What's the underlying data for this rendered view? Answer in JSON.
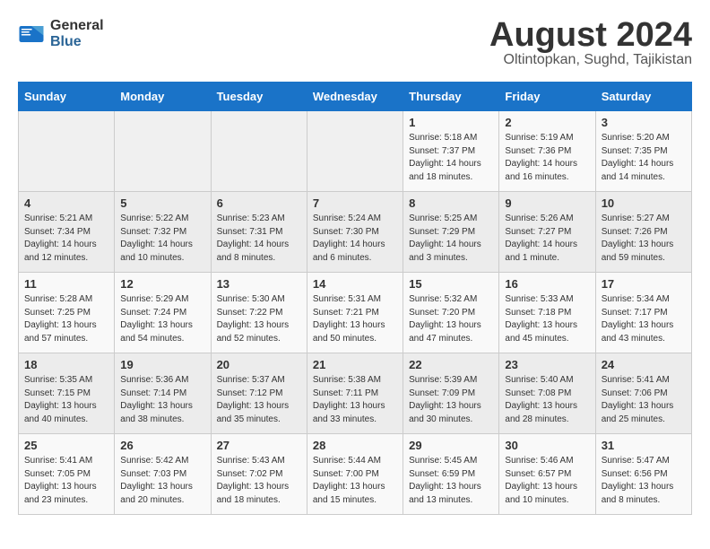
{
  "header": {
    "logo_general": "General",
    "logo_blue": "Blue",
    "month_title": "August 2024",
    "location": "Oltintopkan, Sughd, Tajikistan"
  },
  "weekdays": [
    "Sunday",
    "Monday",
    "Tuesday",
    "Wednesday",
    "Thursday",
    "Friday",
    "Saturday"
  ],
  "weeks": [
    [
      {
        "day": "",
        "info": ""
      },
      {
        "day": "",
        "info": ""
      },
      {
        "day": "",
        "info": ""
      },
      {
        "day": "",
        "info": ""
      },
      {
        "day": "1",
        "info": "Sunrise: 5:18 AM\nSunset: 7:37 PM\nDaylight: 14 hours\nand 18 minutes."
      },
      {
        "day": "2",
        "info": "Sunrise: 5:19 AM\nSunset: 7:36 PM\nDaylight: 14 hours\nand 16 minutes."
      },
      {
        "day": "3",
        "info": "Sunrise: 5:20 AM\nSunset: 7:35 PM\nDaylight: 14 hours\nand 14 minutes."
      }
    ],
    [
      {
        "day": "4",
        "info": "Sunrise: 5:21 AM\nSunset: 7:34 PM\nDaylight: 14 hours\nand 12 minutes."
      },
      {
        "day": "5",
        "info": "Sunrise: 5:22 AM\nSunset: 7:32 PM\nDaylight: 14 hours\nand 10 minutes."
      },
      {
        "day": "6",
        "info": "Sunrise: 5:23 AM\nSunset: 7:31 PM\nDaylight: 14 hours\nand 8 minutes."
      },
      {
        "day": "7",
        "info": "Sunrise: 5:24 AM\nSunset: 7:30 PM\nDaylight: 14 hours\nand 6 minutes."
      },
      {
        "day": "8",
        "info": "Sunrise: 5:25 AM\nSunset: 7:29 PM\nDaylight: 14 hours\nand 3 minutes."
      },
      {
        "day": "9",
        "info": "Sunrise: 5:26 AM\nSunset: 7:27 PM\nDaylight: 14 hours\nand 1 minute."
      },
      {
        "day": "10",
        "info": "Sunrise: 5:27 AM\nSunset: 7:26 PM\nDaylight: 13 hours\nand 59 minutes."
      }
    ],
    [
      {
        "day": "11",
        "info": "Sunrise: 5:28 AM\nSunset: 7:25 PM\nDaylight: 13 hours\nand 57 minutes."
      },
      {
        "day": "12",
        "info": "Sunrise: 5:29 AM\nSunset: 7:24 PM\nDaylight: 13 hours\nand 54 minutes."
      },
      {
        "day": "13",
        "info": "Sunrise: 5:30 AM\nSunset: 7:22 PM\nDaylight: 13 hours\nand 52 minutes."
      },
      {
        "day": "14",
        "info": "Sunrise: 5:31 AM\nSunset: 7:21 PM\nDaylight: 13 hours\nand 50 minutes."
      },
      {
        "day": "15",
        "info": "Sunrise: 5:32 AM\nSunset: 7:20 PM\nDaylight: 13 hours\nand 47 minutes."
      },
      {
        "day": "16",
        "info": "Sunrise: 5:33 AM\nSunset: 7:18 PM\nDaylight: 13 hours\nand 45 minutes."
      },
      {
        "day": "17",
        "info": "Sunrise: 5:34 AM\nSunset: 7:17 PM\nDaylight: 13 hours\nand 43 minutes."
      }
    ],
    [
      {
        "day": "18",
        "info": "Sunrise: 5:35 AM\nSunset: 7:15 PM\nDaylight: 13 hours\nand 40 minutes."
      },
      {
        "day": "19",
        "info": "Sunrise: 5:36 AM\nSunset: 7:14 PM\nDaylight: 13 hours\nand 38 minutes."
      },
      {
        "day": "20",
        "info": "Sunrise: 5:37 AM\nSunset: 7:12 PM\nDaylight: 13 hours\nand 35 minutes."
      },
      {
        "day": "21",
        "info": "Sunrise: 5:38 AM\nSunset: 7:11 PM\nDaylight: 13 hours\nand 33 minutes."
      },
      {
        "day": "22",
        "info": "Sunrise: 5:39 AM\nSunset: 7:09 PM\nDaylight: 13 hours\nand 30 minutes."
      },
      {
        "day": "23",
        "info": "Sunrise: 5:40 AM\nSunset: 7:08 PM\nDaylight: 13 hours\nand 28 minutes."
      },
      {
        "day": "24",
        "info": "Sunrise: 5:41 AM\nSunset: 7:06 PM\nDaylight: 13 hours\nand 25 minutes."
      }
    ],
    [
      {
        "day": "25",
        "info": "Sunrise: 5:41 AM\nSunset: 7:05 PM\nDaylight: 13 hours\nand 23 minutes."
      },
      {
        "day": "26",
        "info": "Sunrise: 5:42 AM\nSunset: 7:03 PM\nDaylight: 13 hours\nand 20 minutes."
      },
      {
        "day": "27",
        "info": "Sunrise: 5:43 AM\nSunset: 7:02 PM\nDaylight: 13 hours\nand 18 minutes."
      },
      {
        "day": "28",
        "info": "Sunrise: 5:44 AM\nSunset: 7:00 PM\nDaylight: 13 hours\nand 15 minutes."
      },
      {
        "day": "29",
        "info": "Sunrise: 5:45 AM\nSunset: 6:59 PM\nDaylight: 13 hours\nand 13 minutes."
      },
      {
        "day": "30",
        "info": "Sunrise: 5:46 AM\nSunset: 6:57 PM\nDaylight: 13 hours\nand 10 minutes."
      },
      {
        "day": "31",
        "info": "Sunrise: 5:47 AM\nSunset: 6:56 PM\nDaylight: 13 hours\nand 8 minutes."
      }
    ]
  ]
}
